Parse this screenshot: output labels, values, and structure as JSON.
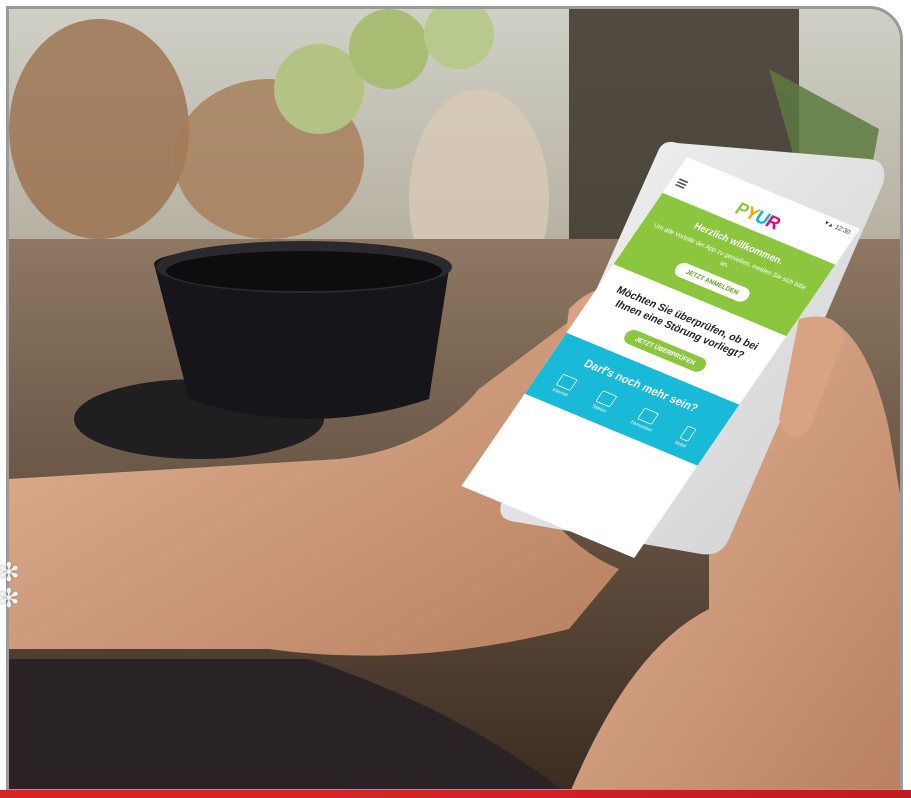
{
  "app": {
    "status_time": "12:30",
    "logo": [
      "P",
      "Y",
      "U",
      "R"
    ],
    "welcome": {
      "title": "Herzlich willkommen.",
      "text": "Um alle Vorteile der App zu genießen, melden Sie sich bitte an.",
      "button": "JETZT ANMELDEN"
    },
    "check": {
      "title": "Möchten Sie überprüfen, ob bei Ihnen eine Störung vorliegt?",
      "button": "JETZT ÜBERPRÜFEN"
    },
    "more": {
      "title": "Darf's noch mehr sein?",
      "icons": [
        "Internet",
        "Telefon",
        "Fernsehen",
        "Mobil"
      ]
    }
  },
  "colors": {
    "brand_green": "#8cc63f",
    "brand_cyan": "#19b9d8",
    "brand_red": "#d8232a"
  }
}
